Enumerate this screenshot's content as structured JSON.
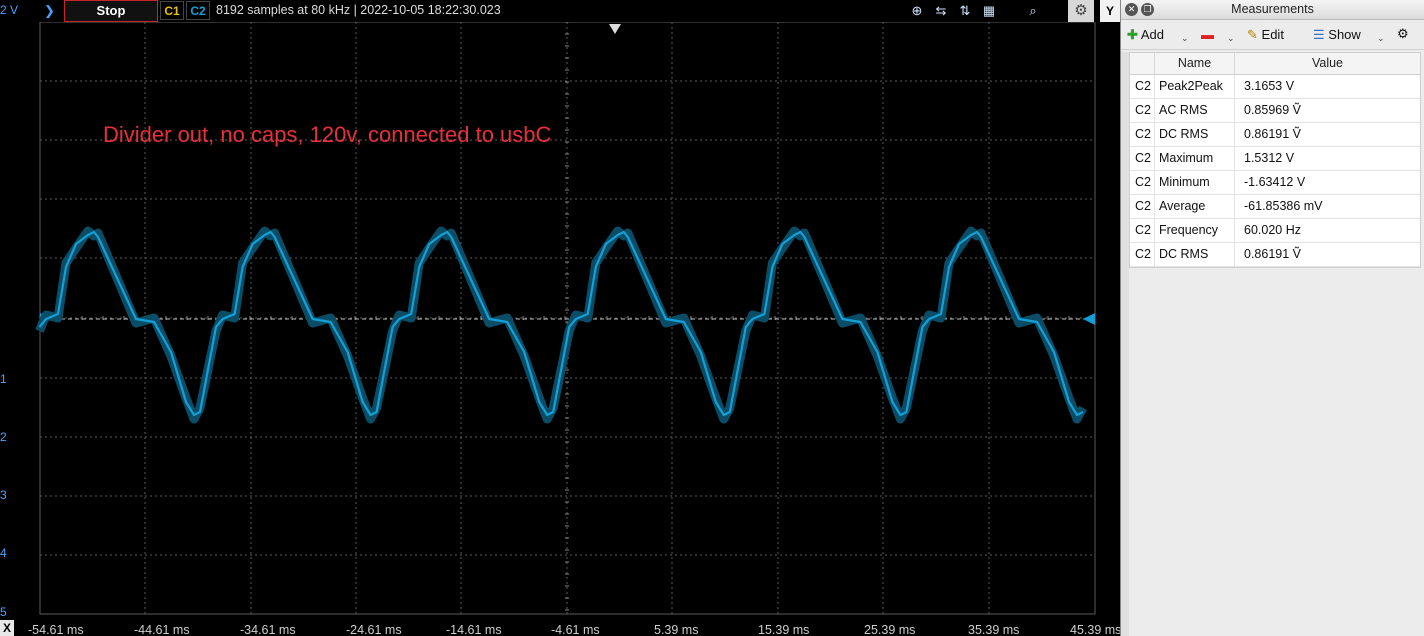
{
  "toolbar": {
    "volt_label": "2 V",
    "run_arrow": "❯",
    "stop_label": "Stop",
    "ch1_label": "C1",
    "ch2_label": "C2",
    "info": "8192 samples at 80 kHz | 2022-10-05 18:22:30.023",
    "icons": [
      "zoom-in-icon",
      "x-zoom-icon",
      "y-zoom-icon",
      "fit-icon",
      "magnify-icon",
      "gear-icon"
    ],
    "y_label": "Y"
  },
  "plot": {
    "annotation": "Divider out, no caps, 120v, connected to usbC",
    "y_ticks": [
      "",
      "1",
      "2",
      "3",
      "4",
      "5"
    ],
    "x_ticks": [
      "-54.61 ms",
      "-44.61 ms",
      "-34.61 ms",
      "-24.61 ms",
      "-14.61 ms",
      "-4.61 ms",
      "5.39 ms",
      "15.39 ms",
      "25.39 ms",
      "35.39 ms",
      "45.39 ms"
    ],
    "x_close": "X",
    "trace_color": "#14a0d6",
    "grid_color": "#5a5a5a"
  },
  "panel": {
    "title": "Measurements",
    "add_label": "Add",
    "edit_label": "Edit",
    "show_label": "Show",
    "columns": [
      "Name",
      "Value"
    ],
    "rows": [
      {
        "ch": "C2",
        "name": "Peak2Peak",
        "value": "3.1653 V"
      },
      {
        "ch": "C2",
        "name": "AC RMS",
        "value": "0.85969 Ṽ"
      },
      {
        "ch": "C2",
        "name": "DC RMS",
        "value": "0.86191 Ṽ"
      },
      {
        "ch": "C2",
        "name": "Maximum",
        "value": "1.5312 V"
      },
      {
        "ch": "C2",
        "name": "Minimum",
        "value": "-1.63412 V"
      },
      {
        "ch": "C2",
        "name": "Average",
        "value": "-61.85386 mV"
      },
      {
        "ch": "C2",
        "name": "Frequency",
        "value": "60.020 Hz"
      },
      {
        "ch": "C2",
        "name": "DC RMS",
        "value": "0.86191 Ṽ"
      }
    ]
  }
}
